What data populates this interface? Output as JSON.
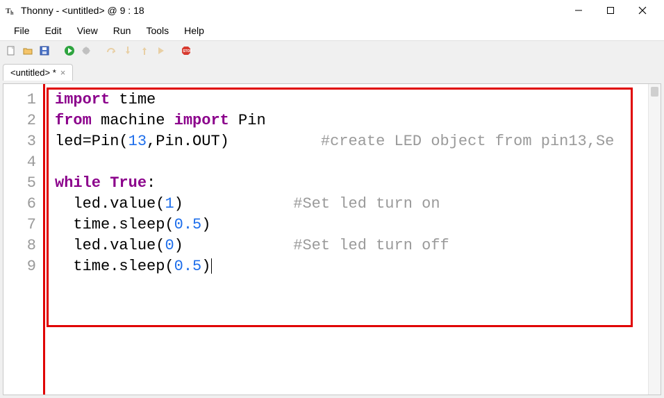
{
  "window": {
    "title": "Thonny  -  <untitled>  @  9 : 18",
    "app_icon_label": "Th"
  },
  "menu": {
    "items": [
      "File",
      "Edit",
      "View",
      "Run",
      "Tools",
      "Help"
    ]
  },
  "toolbar": {
    "icons": {
      "new": "new-file-icon",
      "open": "open-file-icon",
      "save": "save-icon",
      "run": "run-icon",
      "debug": "debug-icon",
      "stepover": "step-over-icon",
      "stepinto": "step-into-icon",
      "stepout": "step-out-icon",
      "resume": "resume-icon",
      "stop": "stop-icon"
    }
  },
  "tab": {
    "label": "<untitled> *"
  },
  "code": {
    "lines": [
      {
        "n": "1",
        "segments": [
          {
            "t": "import",
            "c": "kw"
          },
          {
            "t": " time",
            "c": "mod"
          }
        ]
      },
      {
        "n": "2",
        "segments": [
          {
            "t": "from",
            "c": "kw"
          },
          {
            "t": " machine ",
            "c": "mod"
          },
          {
            "t": "import",
            "c": "kw"
          },
          {
            "t": " Pin",
            "c": "mod"
          }
        ]
      },
      {
        "n": "3",
        "segments": [
          {
            "t": "led=Pin(",
            "c": "mod"
          },
          {
            "t": "13",
            "c": "num"
          },
          {
            "t": ",Pin.OUT)",
            "c": "mod"
          },
          {
            "t": "          ",
            "c": "mod"
          },
          {
            "t": "#create LED object from pin13,Se",
            "c": "cmt"
          }
        ]
      },
      {
        "n": "4",
        "segments": [
          {
            "t": "",
            "c": "mod"
          }
        ]
      },
      {
        "n": "5",
        "segments": [
          {
            "t": "while",
            "c": "kw"
          },
          {
            "t": " ",
            "c": "mod"
          },
          {
            "t": "True",
            "c": "kw"
          },
          {
            "t": ":",
            "c": "mod"
          }
        ]
      },
      {
        "n": "6",
        "segments": [
          {
            "t": "  led.value(",
            "c": "mod"
          },
          {
            "t": "1",
            "c": "num"
          },
          {
            "t": ")",
            "c": "mod"
          },
          {
            "t": "            ",
            "c": "mod"
          },
          {
            "t": "#Set led turn on",
            "c": "cmt"
          }
        ]
      },
      {
        "n": "7",
        "segments": [
          {
            "t": "  time.sleep(",
            "c": "mod"
          },
          {
            "t": "0.5",
            "c": "num"
          },
          {
            "t": ")",
            "c": "mod"
          }
        ]
      },
      {
        "n": "8",
        "segments": [
          {
            "t": "  led.value(",
            "c": "mod"
          },
          {
            "t": "0",
            "c": "num"
          },
          {
            "t": ")",
            "c": "mod"
          },
          {
            "t": "            ",
            "c": "mod"
          },
          {
            "t": "#Set led turn off",
            "c": "cmt"
          }
        ]
      },
      {
        "n": "9",
        "segments": [
          {
            "t": "  time.sleep(",
            "c": "mod"
          },
          {
            "t": "0.5",
            "c": "num"
          },
          {
            "t": ")",
            "c": "mod"
          }
        ],
        "cursor": true
      }
    ]
  }
}
